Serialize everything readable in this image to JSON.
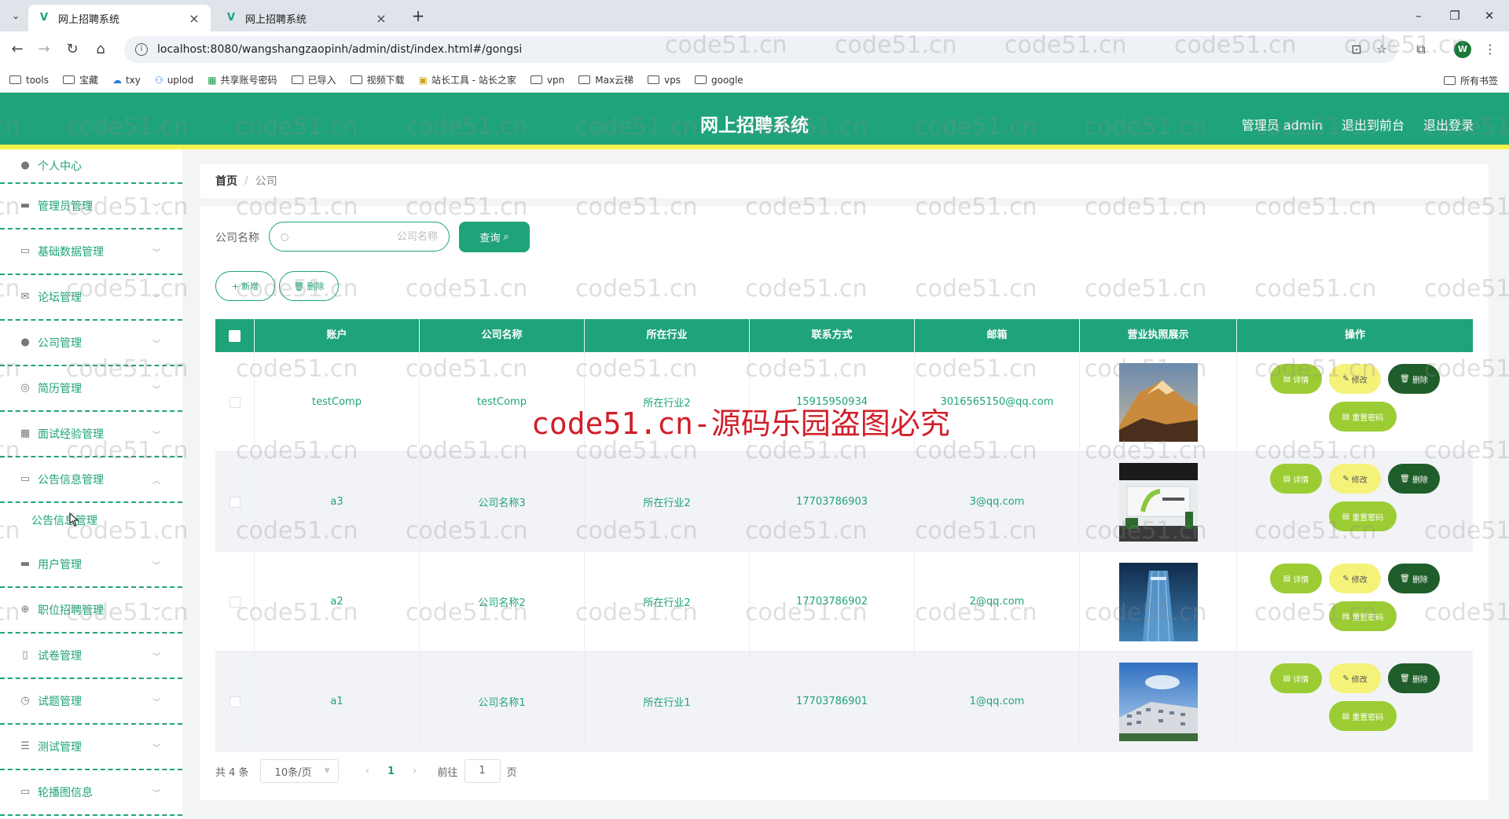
{
  "browser": {
    "tabs": [
      {
        "title": "网上招聘系统",
        "active": true
      },
      {
        "title": "网上招聘系统",
        "active": false
      }
    ],
    "url": "localhost:8080/wangshangzaopinh/admin/dist/index.html#/gongsi",
    "bookmarks": [
      "tools",
      "宝藏",
      "txy",
      "uplod",
      "共享账号密码",
      "已导入",
      "视频下载",
      "站长工具 - 站长之家",
      "vpn",
      "Max云梯",
      "vps",
      "google"
    ],
    "all_bookmarks": "所有书签",
    "profile_initial": "W"
  },
  "header": {
    "title": "网上招聘系统",
    "links": [
      "管理员 admin",
      "退出到前台",
      "退出登录"
    ],
    "accent_color": "#1fa37a",
    "stripe_color": "#f3f34a"
  },
  "sidebar": {
    "items": [
      {
        "label": "个人中心",
        "icon": "user-icon"
      },
      {
        "label": "管理员管理",
        "icon": "briefcase-icon"
      },
      {
        "label": "基础数据管理",
        "icon": "calendar-icon"
      },
      {
        "label": "论坛管理",
        "icon": "mail-icon"
      },
      {
        "label": "公司管理",
        "icon": "user-icon"
      },
      {
        "label": "简历管理",
        "icon": "circle-icon"
      },
      {
        "label": "面试经验管理",
        "icon": "grid-icon"
      },
      {
        "label": "公告信息管理",
        "icon": "message-icon",
        "expanded": true
      },
      {
        "label": "用户管理",
        "icon": "monitor-icon"
      },
      {
        "label": "职位招聘管理",
        "icon": "compass-icon"
      },
      {
        "label": "试卷管理",
        "icon": "phone-icon"
      },
      {
        "label": "试题管理",
        "icon": "clock-icon"
      },
      {
        "label": "测试管理",
        "icon": "list-icon"
      },
      {
        "label": "轮播图信息",
        "icon": "chat-icon"
      }
    ],
    "submenu": "公告信息管理"
  },
  "breadcrumb": {
    "home": "首页",
    "separator": "/",
    "current": "公司"
  },
  "search": {
    "label": "公司名称",
    "placeholder": "公司名称",
    "value": "",
    "query_button": "查询"
  },
  "actions": {
    "add": "新增",
    "delete": "删除"
  },
  "table": {
    "columns": [
      "账户",
      "公司名称",
      "所在行业",
      "联系方式",
      "邮箱",
      "营业执照展示",
      "操作"
    ],
    "rows": [
      {
        "account": "testComp",
        "name": "testComp",
        "industry": "所在行业2",
        "phone": "15915950934",
        "email": "3016565150@qq.com",
        "image": "mountain"
      },
      {
        "account": "a3",
        "name": "公司名称3",
        "industry": "所在行业2",
        "phone": "17703786903",
        "email": "3@qq.com",
        "image": "office"
      },
      {
        "account": "a2",
        "name": "公司名称2",
        "industry": "所在行业2",
        "phone": "17703786902",
        "email": "2@qq.com",
        "image": "tower"
      },
      {
        "account": "a1",
        "name": "公司名称1",
        "industry": "所在行业1",
        "phone": "17703786901",
        "email": "1@qq.com",
        "image": "building"
      }
    ],
    "ops": {
      "detail": "详情",
      "edit": "修改",
      "delete": "删除",
      "reset": "重置密码"
    }
  },
  "pagination": {
    "total": "共 4 条",
    "page_size": "10条/页",
    "current_page": "1",
    "goto_label": "前往",
    "goto_value": "1",
    "page_unit": "页"
  },
  "watermark": {
    "text": "code51.cn",
    "center_text": "code51.cn-源码乐园盗图必究"
  }
}
